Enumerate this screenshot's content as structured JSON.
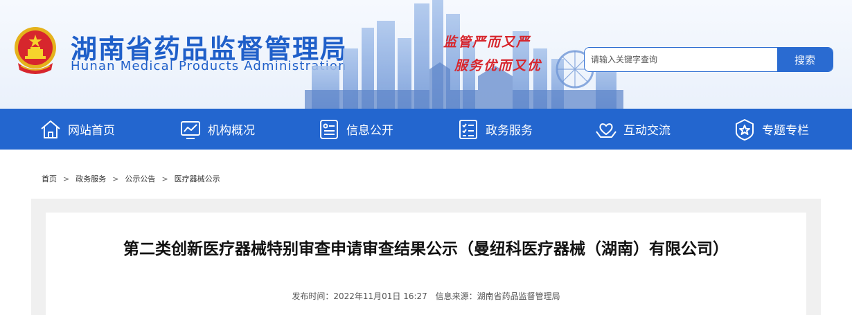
{
  "header": {
    "title_cn": "湖南省药品监督管理局",
    "title_en": "Hunan Medical Products Administration",
    "slogan_line1": "监管严而又严",
    "slogan_line2": "服务优而又优",
    "search": {
      "placeholder": "请输入关键字查询",
      "button_label": "搜索"
    }
  },
  "nav": {
    "items": [
      {
        "label": "网站首页",
        "icon": "home-icon"
      },
      {
        "label": "机构概况",
        "icon": "chart-icon"
      },
      {
        "label": "信息公开",
        "icon": "document-icon"
      },
      {
        "label": "政务服务",
        "icon": "checklist-icon"
      },
      {
        "label": "互动交流",
        "icon": "heart-hands-icon"
      },
      {
        "label": "专题专栏",
        "icon": "star-badge-icon"
      }
    ]
  },
  "breadcrumb": [
    "首页",
    "政务服务",
    "公示公告",
    "医疗器械公示"
  ],
  "breadcrumb_separator": ">",
  "article": {
    "title": "第二类创新医疗器械特别审查申请审查结果公示（曼纽科医疗器械（湖南）有限公司）",
    "publish_time": "发布时间：2022年11月01日 16:27",
    "source": "信息来源：湖南省药品监督管理局"
  },
  "colors": {
    "primary_blue": "#2366cf",
    "title_blue": "#1f5fc9",
    "slogan_red": "#d7262d",
    "content_gray": "#f0f0f0"
  }
}
